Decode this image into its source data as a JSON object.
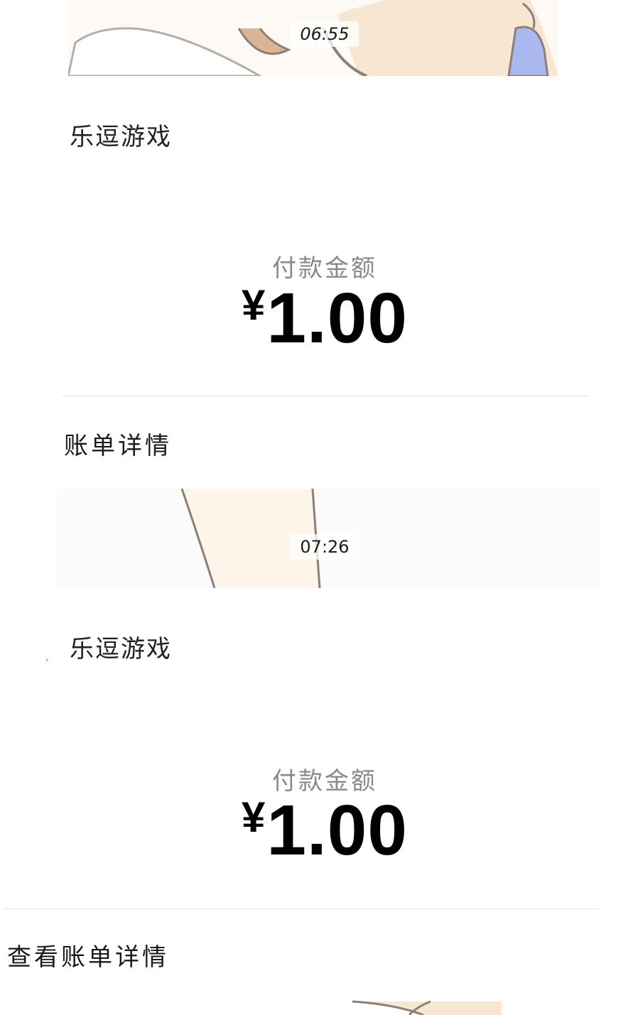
{
  "messages": [
    {
      "time": "06:55",
      "merchant": "乐逗游戏",
      "amount_label": "付款金额",
      "currency_symbol": "¥",
      "amount": "1.00",
      "detail_link": "账单详情"
    },
    {
      "time": "07:26",
      "merchant": "乐逗游戏",
      "amount_label": "付款金额",
      "currency_symbol": "¥",
      "amount": "1.00",
      "detail_link": "查看账单详情"
    }
  ],
  "colors": {
    "background": "#ffffff",
    "label_gray": "#8a8a8a",
    "divider": "#e2e2e2",
    "illustration_skin": "#f6e6d2",
    "illustration_line": "#8c7f7a",
    "illustration_blue": "#a9b8ee",
    "illustration_hair": "#d9b596"
  }
}
